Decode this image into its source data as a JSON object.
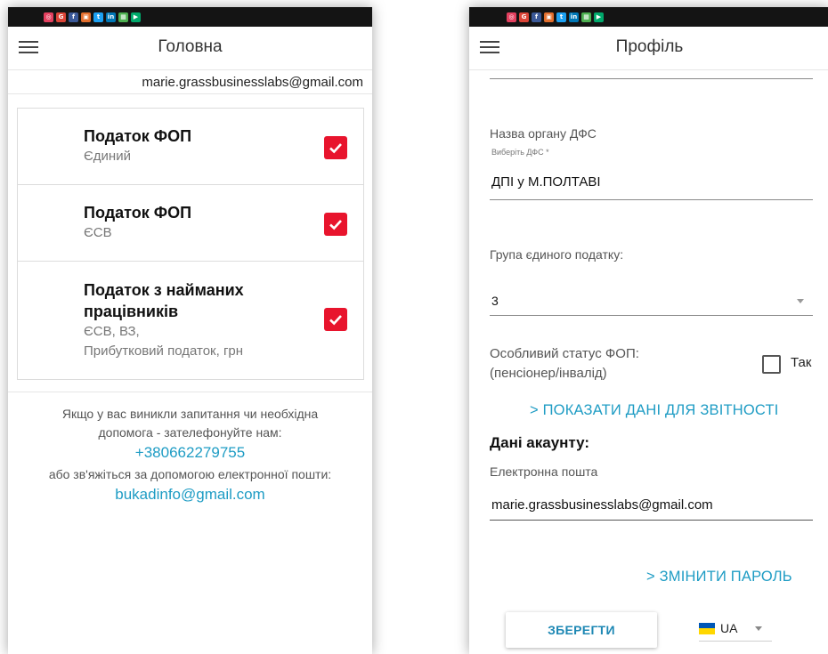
{
  "status_icons": [
    {
      "icon": "instagram-icon",
      "color": "#e4405f",
      "glyph": "◎"
    },
    {
      "icon": "google-icon",
      "color": "#db4437",
      "glyph": "G"
    },
    {
      "icon": "facebook-icon",
      "color": "#3b5998",
      "glyph": "f"
    },
    {
      "icon": "app-icon",
      "color": "#e26e2d",
      "glyph": "▣"
    },
    {
      "icon": "twitter-icon",
      "color": "#1da1f2",
      "glyph": "t"
    },
    {
      "icon": "linkedin-icon",
      "color": "#0077b5",
      "glyph": "in"
    },
    {
      "icon": "photos-icon",
      "color": "#4caf50",
      "glyph": "▦"
    },
    {
      "icon": "play-store-icon",
      "color": "#00a86b",
      "glyph": "▶"
    }
  ],
  "left": {
    "title": "Головна",
    "user_email": "marie.grassbusinesslabs@gmail.com",
    "taxes": [
      {
        "title_lines": [
          "Податок ФОП"
        ],
        "sub_lines": [
          "Єдиний"
        ],
        "checked": true
      },
      {
        "title_lines": [
          "Податок ФОП"
        ],
        "sub_lines": [
          "ЄСВ"
        ],
        "checked": true
      },
      {
        "title_lines": [
          "Податок з найманих",
          "працівників"
        ],
        "sub_lines": [
          "ЄСВ, ВЗ,",
          "Прибутковий податок, грн"
        ],
        "checked": true
      }
    ],
    "help": {
      "line1": "Якщо у вас виникли запитання чи необхідна",
      "line2": "допомога - зателефонуйте нам:",
      "phone": "+380662279755",
      "line3": "або зв'яжіться за допомогою електронної пошти:",
      "email": "bukadinfo@gmail.com"
    }
  },
  "right": {
    "title": "Профіль",
    "dfs": {
      "label": "Назва органу ДФС",
      "hint": "Виберіть ДФС *",
      "value": "ДПІ у М.ПОЛТАВІ"
    },
    "tax_group": {
      "label": "Група єдиного податку:",
      "value": "3"
    },
    "special_status": {
      "line1": "Особливий статус ФОП:",
      "line2": "(пенсіонер/інвалід)",
      "checkbox_label": "Так",
      "checked": false
    },
    "show_report_link": "> ПОКАЗАТИ ДАНІ ДЛЯ ЗВІТНОСТІ",
    "account_heading": "Дані акаунту:",
    "email_label": "Електронна пошта",
    "email_value": "marie.grassbusinesslabs@gmail.com",
    "change_password_link": "> ЗМІНИТИ ПАРОЛЬ",
    "save_button": "ЗБЕРЕГТИ",
    "language": "UA",
    "flag_colors": [
      "#0057b7",
      "#ffd700"
    ]
  },
  "colors": {
    "accent": "#1e9cc4",
    "check": "#e8142d",
    "statusbar": "#141414"
  }
}
